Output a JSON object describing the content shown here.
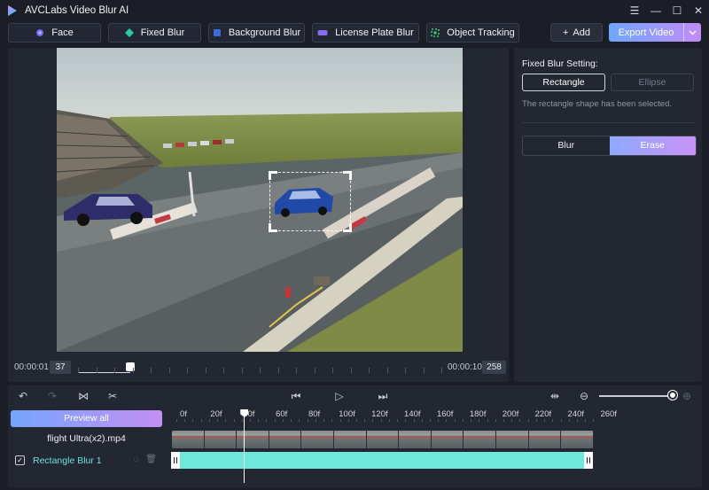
{
  "app": {
    "title": "AVCLabs Video Blur AI",
    "logo_icon": "avclabs-logo-icon"
  },
  "window_controls": [
    "menu-icon",
    "minimize-icon",
    "maximize-icon",
    "close-icon"
  ],
  "modes": [
    {
      "label": "Face",
      "icon": "face-icon"
    },
    {
      "label": "Fixed Blur",
      "icon": "fixed-blur-icon"
    },
    {
      "label": "Background Blur",
      "icon": "background-blur-icon"
    },
    {
      "label": "License Plate Blur",
      "icon": "license-plate-icon"
    },
    {
      "label": "Object Tracking",
      "icon": "object-tracking-icon"
    }
  ],
  "toolbar": {
    "add_label": "Add",
    "export_label": "Export Video"
  },
  "player": {
    "current_time": "00:00:01",
    "current_frame": "37",
    "end_time": "00:00:10",
    "end_frame": "258",
    "progress": 0.143
  },
  "settings": {
    "title": "Fixed Blur Setting:",
    "shape_rectangle": "Rectangle",
    "shape_ellipse": "Ellipse",
    "selected_note": "The rectangle shape has been selected.",
    "mode_blur": "Blur",
    "mode_erase": "Erase",
    "selected_mode": "Erase"
  },
  "timeline": {
    "preview_all_label": "Preview all",
    "file_name": "flight Ultra(x2).mp4",
    "track_label": "Rectangle Blur 1",
    "ruler_labels": [
      "0f",
      "20f",
      "40f",
      "60f",
      "80f",
      "100f",
      "120f",
      "140f",
      "160f",
      "180f",
      "200f",
      "220f",
      "240f",
      "260f"
    ],
    "playhead_frame": 37,
    "zoom_level": 1.0,
    "colors": {
      "accent_start": "#6fa7ff",
      "accent_end": "#c28cf7",
      "track": "#6ee8d8"
    }
  }
}
